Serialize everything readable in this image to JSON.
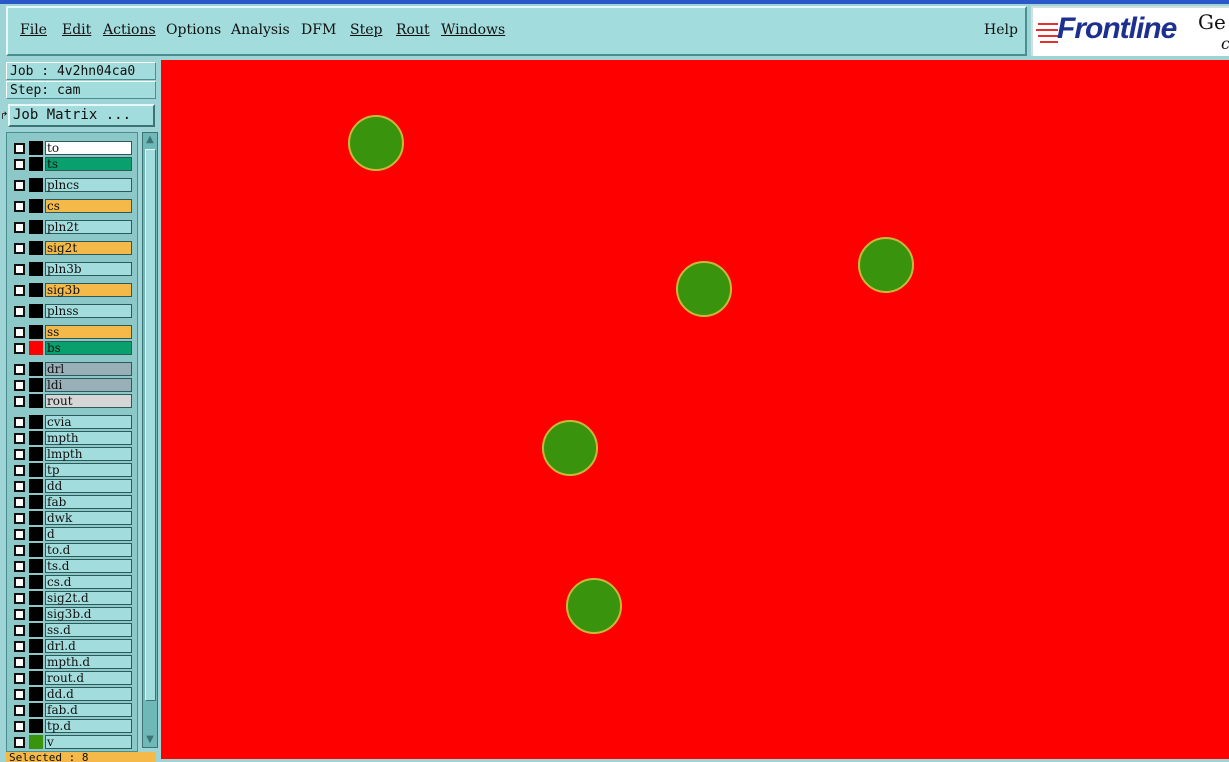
{
  "menu": {
    "items": [
      "File",
      "Edit",
      "Actions",
      "Options",
      "Analysis",
      "DFM",
      "Step",
      "Rout",
      "Windows"
    ],
    "help": "Help"
  },
  "logo": {
    "text": "Frontline",
    "suffix": "Ge",
    "suffix2": "c"
  },
  "job": {
    "label": "Job : 4v2hn04ca0"
  },
  "step": {
    "label": "Step: cam"
  },
  "job_matrix": {
    "label": "Job Matrix ..."
  },
  "layers": [
    {
      "name": "to",
      "color": "#000000",
      "bg": "#ffffff"
    },
    {
      "name": "ts",
      "color": "#000000",
      "bg": "#0aa06e"
    },
    {
      "name": "plncs",
      "color": "#000000",
      "bg": "#a2dcdc"
    },
    {
      "name": "cs",
      "color": "#000000",
      "bg": "#f5b94a"
    },
    {
      "name": "pln2t",
      "color": "#000000",
      "bg": "#a2dcdc"
    },
    {
      "name": "sig2t",
      "color": "#000000",
      "bg": "#f5b94a"
    },
    {
      "name": "pln3b",
      "color": "#000000",
      "bg": "#a2dcdc"
    },
    {
      "name": "sig3b",
      "color": "#000000",
      "bg": "#f5b94a"
    },
    {
      "name": "plnss",
      "color": "#000000",
      "bg": "#a2dcdc"
    },
    {
      "name": "ss",
      "color": "#000000",
      "bg": "#f5b94a"
    },
    {
      "name": "bs",
      "color": "#ff0000",
      "bg": "#0aa06e"
    },
    {
      "name": "drl",
      "color": "#000000",
      "bg": "#9ab0b8"
    },
    {
      "name": "ldi",
      "color": "#000000",
      "bg": "#9ab0b8"
    },
    {
      "name": "rout",
      "color": "#000000",
      "bg": "#d6d6d6"
    },
    {
      "name": "cvia",
      "color": "#000000",
      "bg": "#a2dcdc"
    },
    {
      "name": "mpth",
      "color": "#000000",
      "bg": "#a2dcdc"
    },
    {
      "name": "lmpth",
      "color": "#000000",
      "bg": "#a2dcdc"
    },
    {
      "name": "tp",
      "color": "#000000",
      "bg": "#a2dcdc"
    },
    {
      "name": "dd",
      "color": "#000000",
      "bg": "#a2dcdc"
    },
    {
      "name": "fab",
      "color": "#000000",
      "bg": "#a2dcdc"
    },
    {
      "name": "dwk",
      "color": "#000000",
      "bg": "#a2dcdc"
    },
    {
      "name": "d",
      "color": "#000000",
      "bg": "#a2dcdc"
    },
    {
      "name": "to.d",
      "color": "#000000",
      "bg": "#a2dcdc"
    },
    {
      "name": "ts.d",
      "color": "#000000",
      "bg": "#a2dcdc"
    },
    {
      "name": "cs.d",
      "color": "#000000",
      "bg": "#a2dcdc"
    },
    {
      "name": "sig2t.d",
      "color": "#000000",
      "bg": "#a2dcdc"
    },
    {
      "name": "sig3b.d",
      "color": "#000000",
      "bg": "#a2dcdc"
    },
    {
      "name": "ss.d",
      "color": "#000000",
      "bg": "#a2dcdc"
    },
    {
      "name": "drl.d",
      "color": "#000000",
      "bg": "#a2dcdc"
    },
    {
      "name": "mpth.d",
      "color": "#000000",
      "bg": "#a2dcdc"
    },
    {
      "name": "rout.d",
      "color": "#000000",
      "bg": "#a2dcdc"
    },
    {
      "name": "dd.d",
      "color": "#000000",
      "bg": "#a2dcdc"
    },
    {
      "name": "fab.d",
      "color": "#000000",
      "bg": "#a2dcdc"
    },
    {
      "name": "tp.d",
      "color": "#000000",
      "bg": "#a2dcdc"
    },
    {
      "name": "v",
      "color": "#3a930d",
      "bg": "#a2dcdc"
    }
  ],
  "selected": {
    "label": "Selected : 8"
  },
  "canvas": {
    "background": "#ff0000",
    "pad_color": "#3a930d",
    "pad_outline": "#c8b83a"
  }
}
